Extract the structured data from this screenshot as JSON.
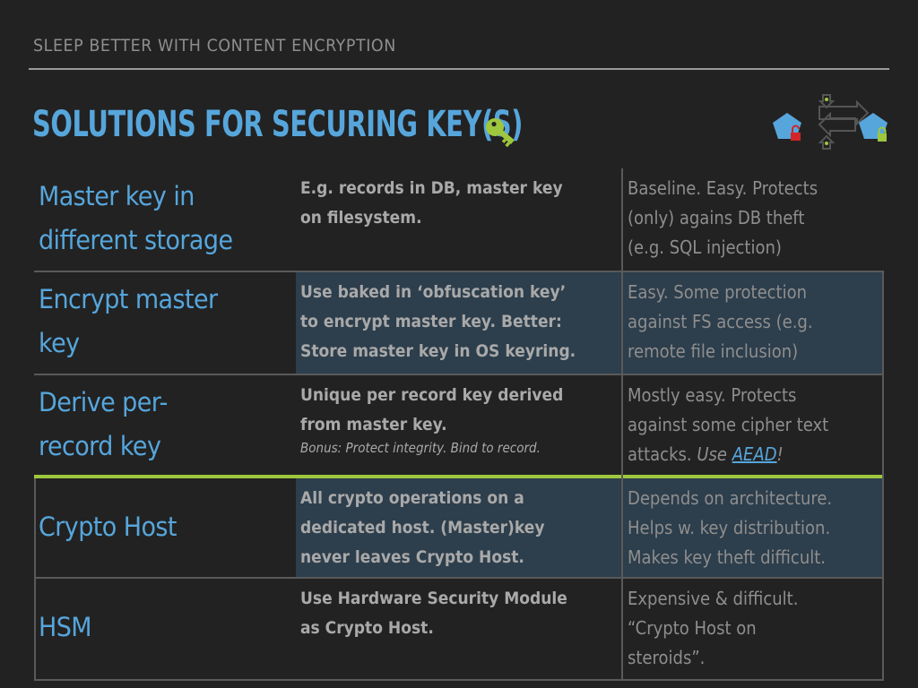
{
  "kicker": "SLEEP BETTER WITH CONTENT ENCRYPTION",
  "title": "SOLUTIONS FOR SECURING KEY(S)",
  "icons": {
    "title_icon": "key-icon",
    "logo": "encrypted-transfer-diagram-icon"
  },
  "colors": {
    "accent_blue": "#56a6dc",
    "accent_green": "#9ec73d",
    "lock_red": "#d0262a",
    "shade": "#2d3e4c",
    "background": "#222222"
  },
  "rows": [
    {
      "label_lines": [
        "Master key in",
        "different storage"
      ],
      "description_lines": [
        "E.g. records in DB, master key",
        "on filesystem."
      ],
      "note_lines": [
        "Baseline. Easy. Protects",
        "(only) agains DB theft",
        "(e.g. SQL injection)"
      ],
      "highlighted": false
    },
    {
      "label_lines": [
        "Encrypt master",
        "key"
      ],
      "description_lines": [
        "Use baked in ‘obfuscation key’",
        "to encrypt master key. Better:",
        "Store master key in OS keyring."
      ],
      "note_lines": [
        "Easy. Some protection",
        "against FS access (e.g.",
        "remote file inclusion)"
      ],
      "highlighted": true
    },
    {
      "label_lines": [
        "Derive per-",
        "record key"
      ],
      "description_lines": [
        "Unique per record key derived",
        "from master key."
      ],
      "description_note": "Bonus: Protect integrity. Bind to record.",
      "note_lines": [
        "Mostly easy. Protects",
        "against some cipher text"
      ],
      "note_last_prefix": "attacks. ",
      "note_last_emphasis": "Use ",
      "note_link": "AEAD",
      "note_last_suffix": "!",
      "highlighted": false
    },
    {
      "label_lines": [
        "Crypto Host"
      ],
      "description_lines": [
        "All crypto operations on a",
        "dedicated host. (Master)key",
        "never leaves Crypto Host."
      ],
      "note_lines": [
        "Depends on architecture.",
        "Helps w. key distribution.",
        "Makes key theft difficult."
      ],
      "highlighted": true
    },
    {
      "label_lines": [
        "HSM"
      ],
      "description_lines": [
        "Use Hardware Security Module",
        "as Crypto Host."
      ],
      "note_lines": [
        "Expensive & difficult.",
        "“Crypto Host on",
        "steroids”."
      ],
      "highlighted": false
    }
  ]
}
